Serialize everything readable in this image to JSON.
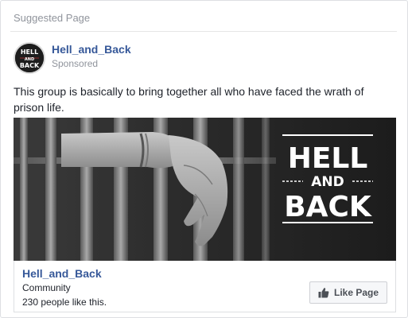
{
  "header": {
    "label": "Suggested Page"
  },
  "page": {
    "name": "Hell_and_Back",
    "sponsored_label": "Sponsored",
    "avatar_lines": [
      "HELL",
      "AND",
      "BACK"
    ]
  },
  "post": {
    "text": "This group is basically to bring together all who have faced the wrath of prison life."
  },
  "ad_image": {
    "title_line1": "HELL",
    "title_line2": "AND",
    "title_line3": "BACK"
  },
  "footer": {
    "name": "Hell_and_Back",
    "category": "Community",
    "likes_text": "230 people like this.",
    "like_button_label": "Like Page",
    "like_icon": "thumbs-up-icon"
  },
  "colors": {
    "link": "#365899",
    "muted": "#90949c",
    "text": "#1d2129",
    "border": "#dddfe2"
  }
}
